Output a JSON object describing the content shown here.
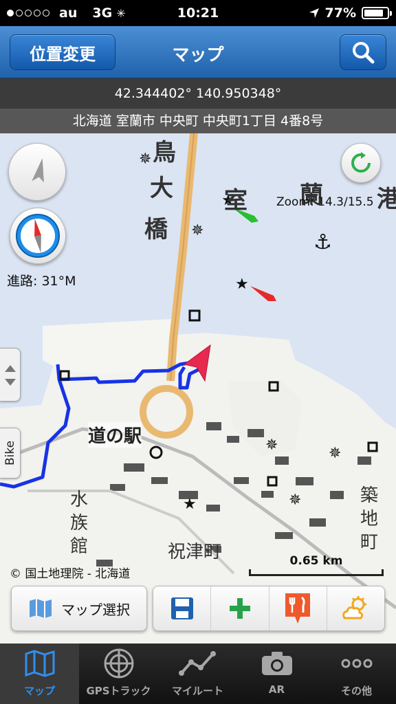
{
  "status_bar": {
    "carrier": "au",
    "network": "3G",
    "time": "10:21",
    "battery": "77%"
  },
  "nav": {
    "left_button": "位置変更",
    "title": "マップ",
    "search_icon": "search-icon"
  },
  "info": {
    "coordinates": "42.344402° 140.950348°",
    "address": "北海道 室蘭市 中央町 中央町1丁目 4番8号"
  },
  "map": {
    "course": "進路: 31°M",
    "zoom": "Zoom: 14.3/15.5",
    "side_label": "Bike",
    "copyright": "© 国土地理院 - 北海道",
    "scale": "0.65 km",
    "labels": {
      "l1": "鳥",
      "l2": "大",
      "l3": "橋",
      "l4": "室",
      "l5": "蘭",
      "l6": "港",
      "station": "道の駅",
      "l7": "水",
      "l8": "族",
      "l9": "館",
      "town": "祝津町",
      "l10": "築",
      "l11": "地",
      "l12": "町"
    }
  },
  "toolbar": {
    "map_select": "マップ選択",
    "colors": {
      "save": "#1f62ad",
      "add": "#27a24a",
      "food": "#ee5a2c",
      "weather": "#f0a81e"
    }
  },
  "tabs": [
    {
      "label": "マップ",
      "icon": "map-icon",
      "active": true
    },
    {
      "label": "GPSトラック",
      "icon": "radar-icon",
      "active": false
    },
    {
      "label": "マイルート",
      "icon": "route-icon",
      "active": false
    },
    {
      "label": "AR",
      "icon": "camera-icon",
      "active": false
    },
    {
      "label": "その他",
      "icon": "more-icon",
      "active": false
    }
  ]
}
